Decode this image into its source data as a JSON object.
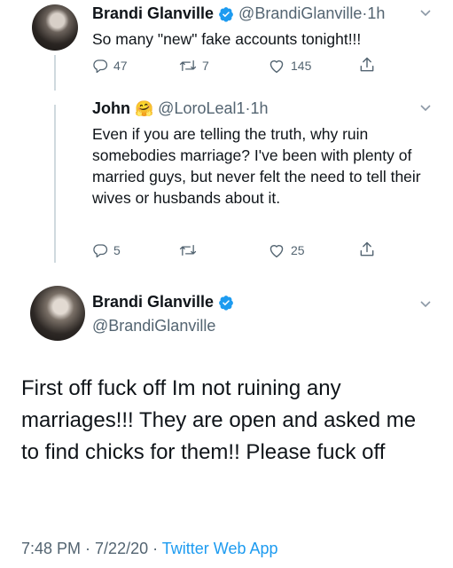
{
  "tweet1": {
    "name": "Brandi Glanville",
    "handle": "@BrandiGlanville",
    "time_sep": " · ",
    "time": "1h",
    "text": "So many \"new\" fake accounts tonight!!!",
    "replies": "47",
    "retweets": "7",
    "likes": "145"
  },
  "tweet2": {
    "name": "John",
    "emoji": "🤗",
    "handle": "@LoroLeal1",
    "time_sep": " · ",
    "time": "1h",
    "text": "Even if you are telling the truth, why ruin somebodies marriage? I've been with plenty of married guys, but never felt the need to tell their wives or husbands about it.",
    "replies": "5",
    "retweets": "",
    "likes": "25"
  },
  "main": {
    "name": "Brandi Glanville",
    "handle": "@BrandiGlanville",
    "text": "First off fuck off Im not ruining any marriages!!! They are open and asked me to find chicks for them!! Please fuck off",
    "time": "7:48 PM",
    "date_sep": " · ",
    "date": "7/22/20",
    "app_sep": " · ",
    "app": "Twitter Web App"
  },
  "colors": {
    "verified": "#1d9bf0",
    "link": "#1d9bf0",
    "secondary": "#536471"
  },
  "icons": [
    "reply-icon",
    "retweet-icon",
    "like-icon",
    "share-icon",
    "chevron-down-icon",
    "verified-badge-icon"
  ]
}
